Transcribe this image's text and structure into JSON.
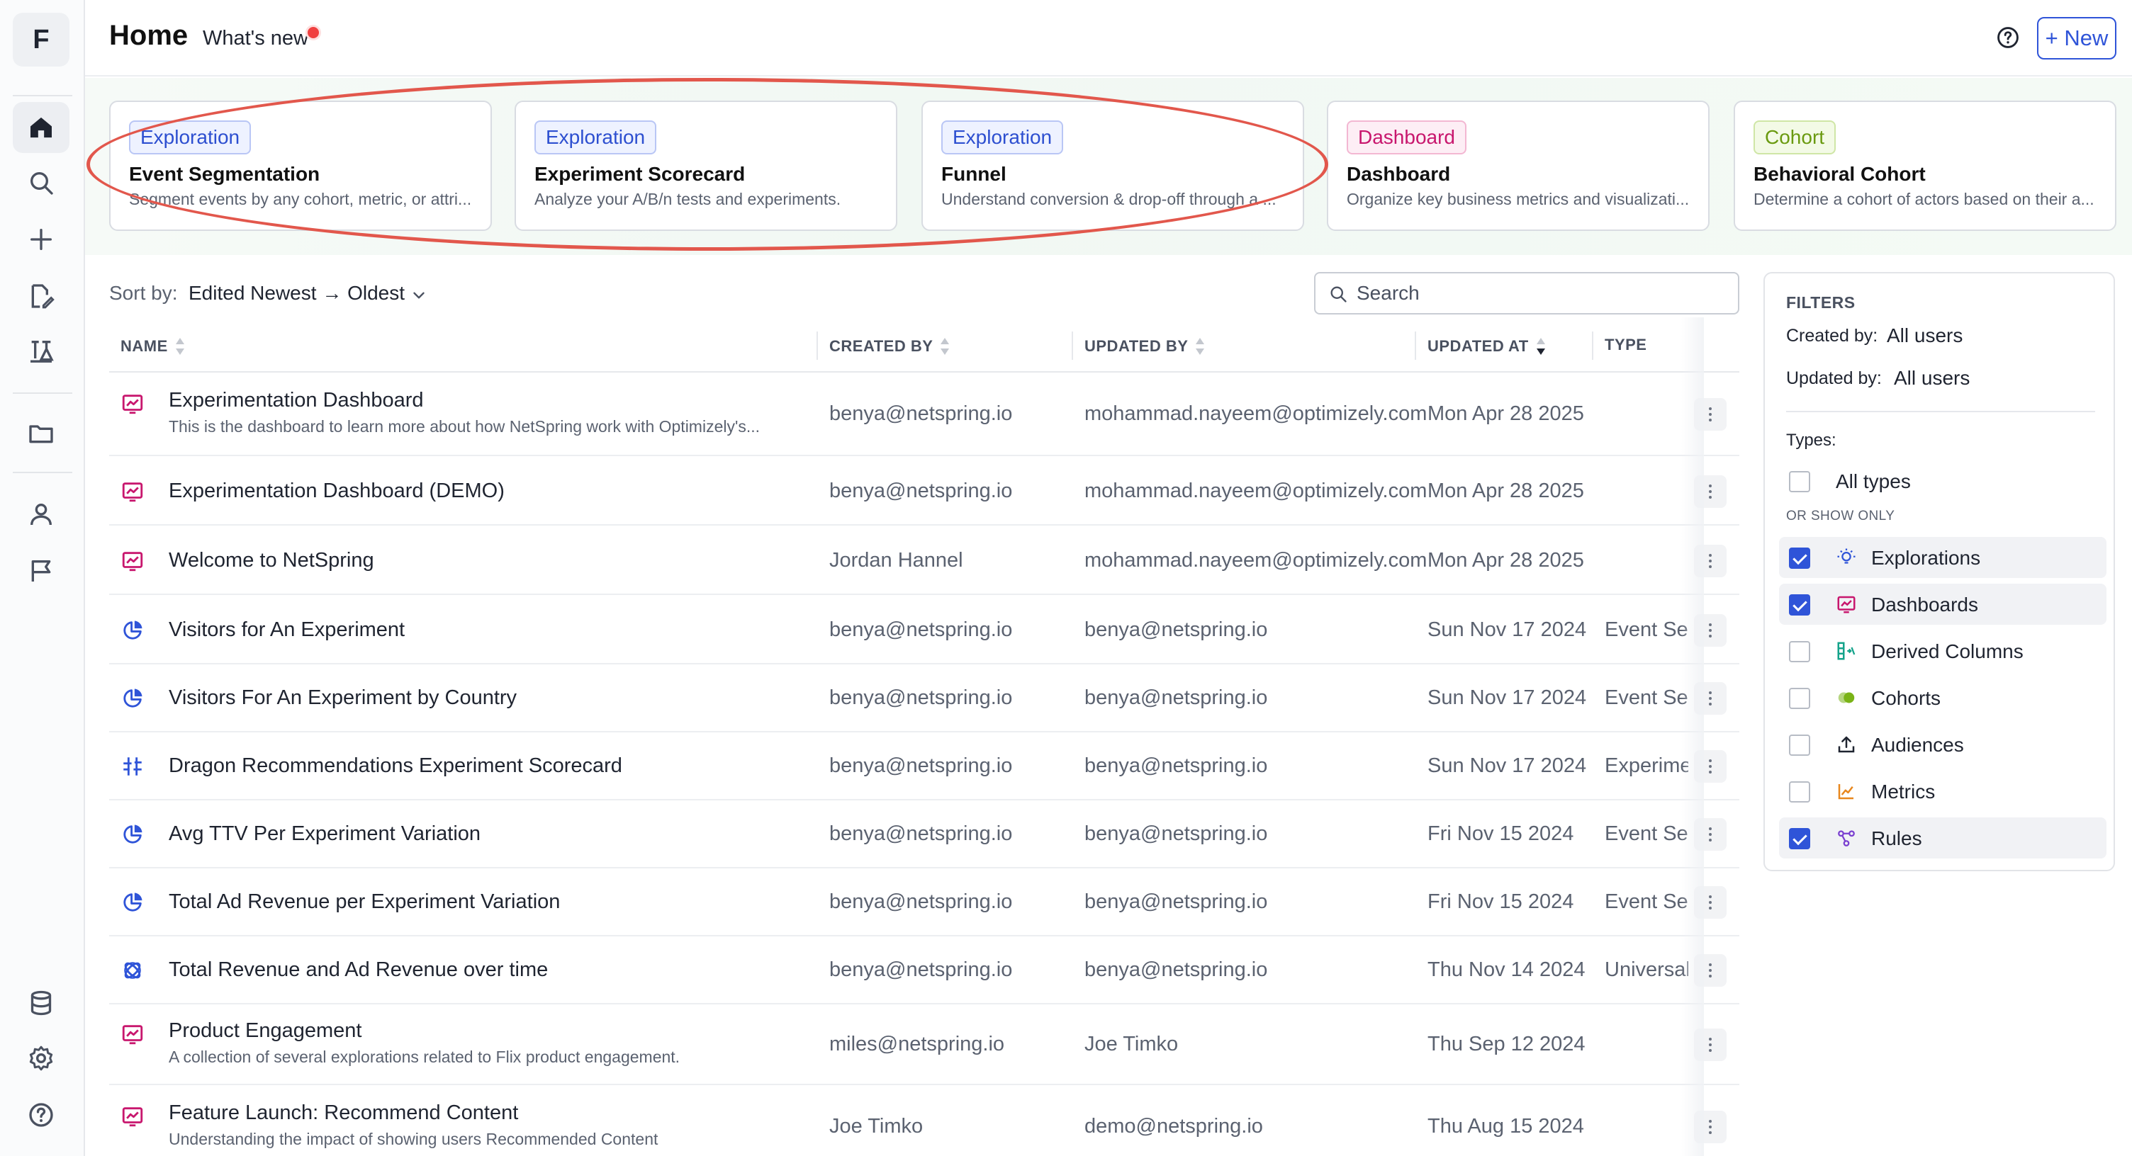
{
  "app": {
    "logo_letter": "F"
  },
  "header": {
    "title": "Home",
    "whats_new": "What's new",
    "new_button": "+ New"
  },
  "sidebar": {
    "items": [
      {
        "name": "home-icon"
      },
      {
        "name": "search-icon"
      },
      {
        "name": "plus-icon"
      },
      {
        "name": "edit-icon"
      },
      {
        "name": "flask-icon"
      },
      {
        "name": "folder-icon"
      },
      {
        "name": "user-icon"
      },
      {
        "name": "flag-icon"
      },
      {
        "name": "database-icon"
      },
      {
        "name": "gear-icon"
      },
      {
        "name": "help-icon"
      }
    ]
  },
  "templates": [
    {
      "badge": "Exploration",
      "kind": "exploration",
      "title": "Event Segmentation",
      "desc": "Segment events by any cohort, metric, or attri..."
    },
    {
      "badge": "Exploration",
      "kind": "exploration",
      "title": "Experiment Scorecard",
      "desc": "Analyze your A/B/n tests and experiments."
    },
    {
      "badge": "Exploration",
      "kind": "exploration",
      "title": "Funnel",
      "desc": "Understand conversion & drop-off through a ..."
    },
    {
      "badge": "Dashboard",
      "kind": "dashboard",
      "title": "Dashboard",
      "desc": "Organize key business metrics and visualizati..."
    },
    {
      "badge": "Cohort",
      "kind": "cohort",
      "title": "Behavioral Cohort",
      "desc": "Determine a cohort of actors based on their a..."
    }
  ],
  "sort": {
    "label": "Sort by:",
    "value": "Edited Newest → Oldest"
  },
  "search": {
    "placeholder": "Search"
  },
  "table": {
    "columns": {
      "name": "NAME",
      "created_by": "CREATED BY",
      "updated_by": "UPDATED BY",
      "updated_at": "UPDATED AT",
      "type": "TYPE"
    },
    "rows": [
      {
        "icon": "dashboard",
        "name": "Experimentation Dashboard",
        "desc": "This is the dashboard to learn more about how NetSpring work with Optimizely's...",
        "created_by": "benya@netspring.io",
        "updated_by": "mohammad.nayeem@optimizely.com",
        "updated_at": "Mon Apr 28 2025",
        "type": ""
      },
      {
        "icon": "dashboard",
        "name": "Experimentation Dashboard (DEMO)",
        "desc": "",
        "created_by": "benya@netspring.io",
        "updated_by": "mohammad.nayeem@optimizely.com",
        "updated_at": "Mon Apr 28 2025",
        "type": ""
      },
      {
        "icon": "dashboard",
        "name": "Welcome to NetSpring",
        "desc": "",
        "created_by": "Jordan Hannel",
        "updated_by": "mohammad.nayeem@optimizely.com",
        "updated_at": "Mon Apr 28 2025",
        "type": ""
      },
      {
        "icon": "pie",
        "name": "Visitors for An Experiment",
        "desc": "",
        "created_by": "benya@netspring.io",
        "updated_by": "benya@netspring.io",
        "updated_at": "Sun Nov 17 2024",
        "type": "Event Segmentation"
      },
      {
        "icon": "pie",
        "name": "Visitors For An Experiment by Country",
        "desc": "",
        "created_by": "benya@netspring.io",
        "updated_by": "benya@netspring.io",
        "updated_at": "Sun Nov 17 2024",
        "type": "Event Segmentation"
      },
      {
        "icon": "scorecard",
        "name": "Dragon Recommendations Experiment Scorecard",
        "desc": "",
        "created_by": "benya@netspring.io",
        "updated_by": "benya@netspring.io",
        "updated_at": "Sun Nov 17 2024",
        "type": "Experiment Scorecard"
      },
      {
        "icon": "pie",
        "name": "Avg TTV Per Experiment Variation",
        "desc": "",
        "created_by": "benya@netspring.io",
        "updated_by": "benya@netspring.io",
        "updated_at": "Fri Nov 15 2024",
        "type": "Event Segmentation"
      },
      {
        "icon": "pie",
        "name": "Total Ad Revenue per Experiment Variation",
        "desc": "",
        "created_by": "benya@netspring.io",
        "updated_by": "benya@netspring.io",
        "updated_at": "Fri Nov 15 2024",
        "type": "Event Segmentation"
      },
      {
        "icon": "universal",
        "name": "Total Revenue and Ad Revenue over time",
        "desc": "",
        "created_by": "benya@netspring.io",
        "updated_by": "benya@netspring.io",
        "updated_at": "Thu Nov 14 2024",
        "type": "Universal"
      },
      {
        "icon": "dashboard",
        "name": "Product Engagement",
        "desc": "A collection of several explorations related to Flix product engagement.",
        "created_by": "miles@netspring.io",
        "updated_by": "Joe Timko",
        "updated_at": "Thu Sep 12 2024",
        "type": ""
      },
      {
        "icon": "dashboard",
        "name": "Feature Launch: Recommend Content",
        "desc": "Understanding the impact of showing users Recommended Content",
        "created_by": "Joe Timko",
        "updated_by": "demo@netspring.io",
        "updated_at": "Thu Aug 15 2024",
        "type": ""
      }
    ]
  },
  "filters": {
    "title": "FILTERS",
    "created_by_label": "Created by:",
    "created_by_value": "All users",
    "updated_by_label": "Updated by:",
    "updated_by_value": "All users",
    "types_label": "Types:",
    "all_types": "All types",
    "or_show_only": "OR SHOW ONLY",
    "options": [
      {
        "label": "Explorations",
        "checked": true,
        "icon": "bulb-icon",
        "color": "#2f54d8"
      },
      {
        "label": "Dashboards",
        "checked": true,
        "icon": "dashboard-icon",
        "color": "#c8176e"
      },
      {
        "label": "Derived Columns",
        "checked": false,
        "icon": "derived-column-icon",
        "color": "#14a38b"
      },
      {
        "label": "Cohorts",
        "checked": false,
        "icon": "cohort-icon",
        "color": "#7ab317"
      },
      {
        "label": "Audiences",
        "checked": false,
        "icon": "upload-icon",
        "color": "#1f2430"
      },
      {
        "label": "Metrics",
        "checked": false,
        "icon": "metric-icon",
        "color": "#e8871e"
      },
      {
        "label": "Rules",
        "checked": true,
        "icon": "rules-icon",
        "color": "#7a3fd0"
      }
    ]
  }
}
